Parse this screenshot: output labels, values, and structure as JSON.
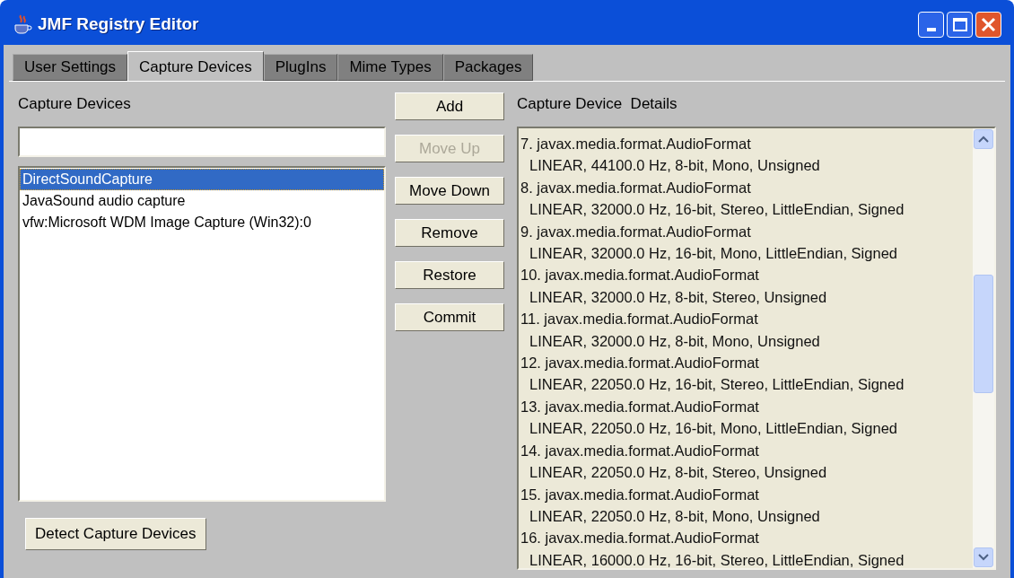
{
  "window": {
    "title": "JMF Registry Editor"
  },
  "tabs": [
    {
      "label": "User Settings",
      "selected": false
    },
    {
      "label": "Capture Devices",
      "selected": true
    },
    {
      "label": "PlugIns",
      "selected": false
    },
    {
      "label": "Mime Types",
      "selected": false
    },
    {
      "label": "Packages",
      "selected": false
    }
  ],
  "devices_panel": {
    "label": "Capture Devices",
    "items": [
      {
        "label": "DirectSoundCapture",
        "selected": true
      },
      {
        "label": "JavaSound audio capture",
        "selected": false
      },
      {
        "label": "vfw:Microsoft WDM Image Capture (Win32):0",
        "selected": false
      }
    ],
    "detect_button": "Detect Capture Devices"
  },
  "buttons": [
    {
      "label": "Add",
      "disabled": false
    },
    {
      "label": "Move Up",
      "disabled": true
    },
    {
      "label": "Move Down",
      "disabled": false
    },
    {
      "label": "Remove",
      "disabled": false
    },
    {
      "label": "Restore",
      "disabled": false
    },
    {
      "label": "Commit",
      "disabled": false
    }
  ],
  "details": {
    "label": "Capture Device  Details",
    "entries": [
      {
        "header": "7. javax.media.format.AudioFormat",
        "format": "LINEAR, 44100.0 Hz, 8-bit, Mono, Unsigned"
      },
      {
        "header": "8. javax.media.format.AudioFormat",
        "format": "LINEAR, 32000.0 Hz, 16-bit, Stereo, LittleEndian, Signed"
      },
      {
        "header": "9. javax.media.format.AudioFormat",
        "format": "LINEAR, 32000.0 Hz, 16-bit, Mono, LittleEndian, Signed"
      },
      {
        "header": "10. javax.media.format.AudioFormat",
        "format": "LINEAR, 32000.0 Hz, 8-bit, Stereo, Unsigned"
      },
      {
        "header": "11. javax.media.format.AudioFormat",
        "format": "LINEAR, 32000.0 Hz, 8-bit, Mono, Unsigned"
      },
      {
        "header": "12. javax.media.format.AudioFormat",
        "format": "LINEAR, 22050.0 Hz, 16-bit, Stereo, LittleEndian, Signed"
      },
      {
        "header": "13. javax.media.format.AudioFormat",
        "format": "LINEAR, 22050.0 Hz, 16-bit, Mono, LittleEndian, Signed"
      },
      {
        "header": "14. javax.media.format.AudioFormat",
        "format": "LINEAR, 22050.0 Hz, 8-bit, Stereo, Unsigned"
      },
      {
        "header": "15. javax.media.format.AudioFormat",
        "format": "LINEAR, 22050.0 Hz, 8-bit, Mono, Unsigned"
      },
      {
        "header": "16. javax.media.format.AudioFormat",
        "format": "LINEAR, 16000.0 Hz, 16-bit, Stereo, LittleEndian, Signed"
      }
    ]
  }
}
